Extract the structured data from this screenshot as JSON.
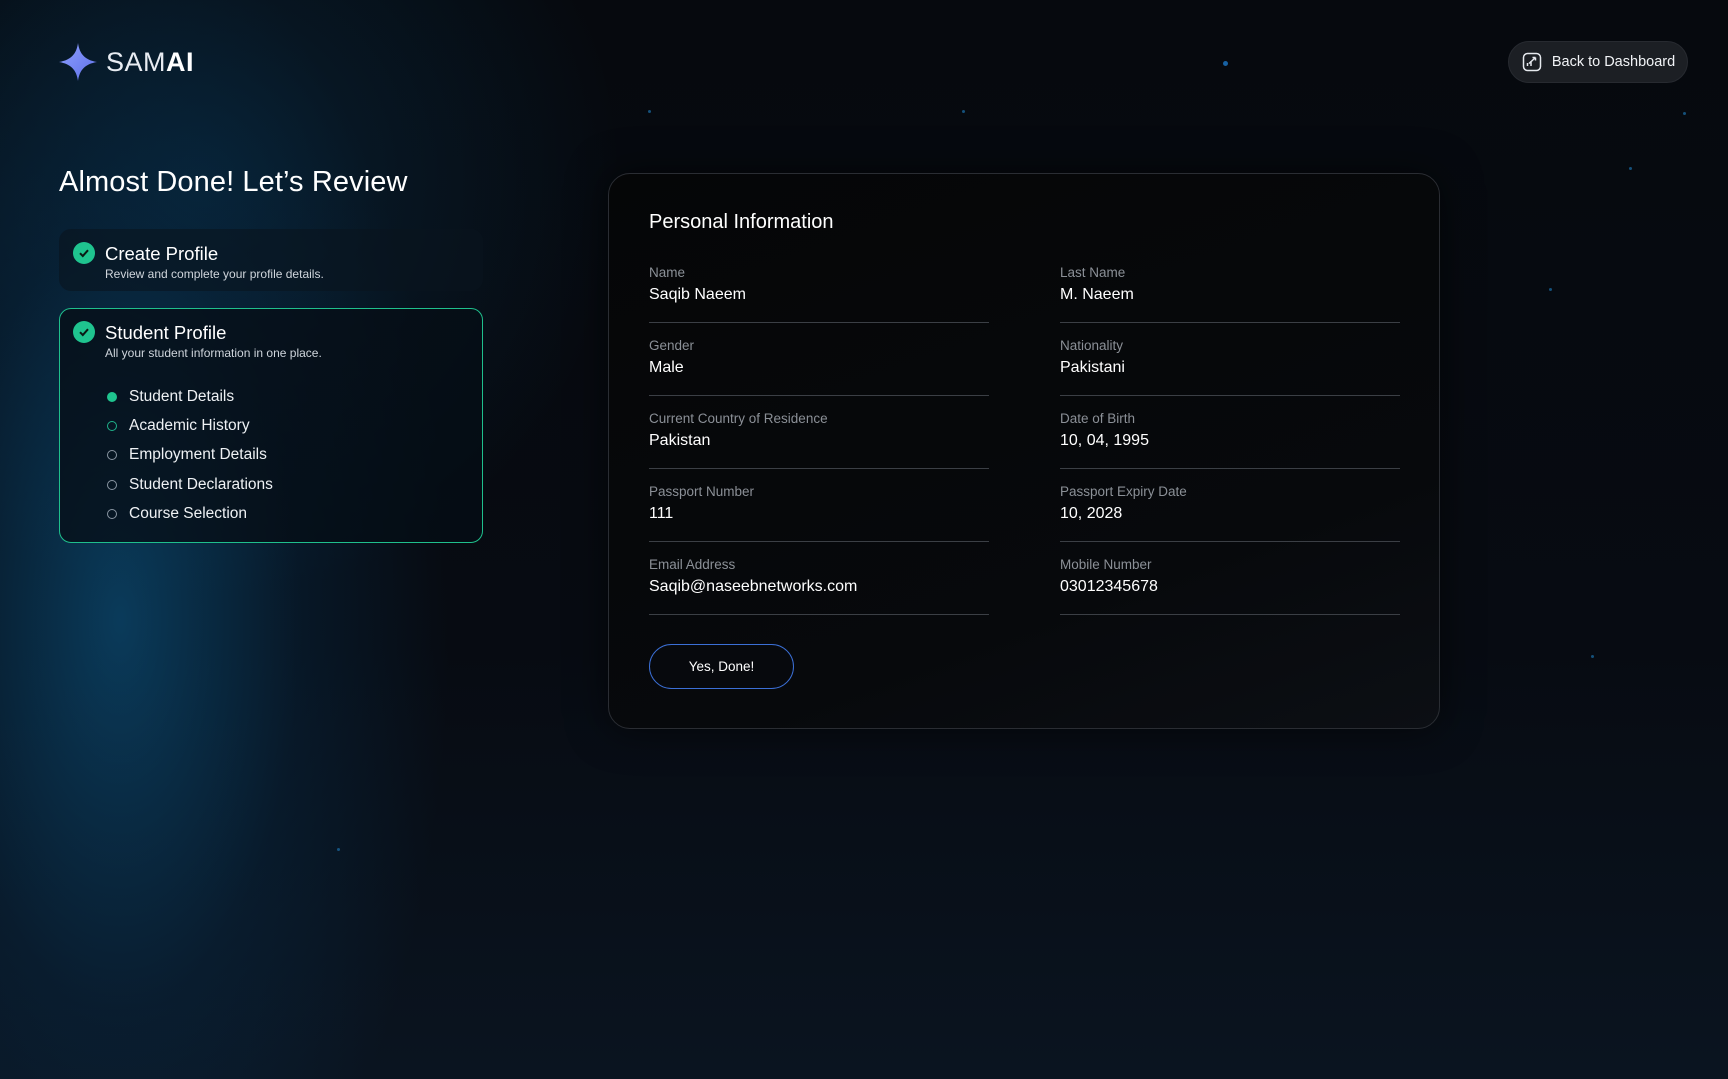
{
  "brand": {
    "logo_light": "SAM",
    "logo_bold": "AI",
    "accent": "#7b8cff"
  },
  "header": {
    "back_label": "Back to Dashboard",
    "back_icon": "chart-box-icon"
  },
  "review": {
    "title": "Almost Done! Let’s Review",
    "steps": [
      {
        "title": "Create Profile",
        "subtitle": "Review and complete your profile details.",
        "status": "complete"
      },
      {
        "title": "Student Profile",
        "subtitle": "All your student information in one place.",
        "status": "complete",
        "items": [
          {
            "label": "Student Details",
            "state": "active"
          },
          {
            "label": "Academic History",
            "state": "pending"
          },
          {
            "label": "Employment Details",
            "state": "pending"
          },
          {
            "label": "Student Declarations",
            "state": "pending"
          },
          {
            "label": "Course Selection",
            "state": "pending"
          }
        ]
      }
    ]
  },
  "personal": {
    "title": "Personal Information",
    "fields": [
      {
        "label": "Name",
        "value": "Saqib Naeem"
      },
      {
        "label": "Last Name",
        "value": "M. Naeem"
      },
      {
        "label": "Gender",
        "value": "Male"
      },
      {
        "label": "Nationality",
        "value": "Pakistani"
      },
      {
        "label": "Current Country of Residence",
        "value": "Pakistan"
      },
      {
        "label": "Date of Birth",
        "value": "10, 04, 1995"
      },
      {
        "label": "Passport Number",
        "value": "111"
      },
      {
        "label": "Passport Expiry Date",
        "value": "10, 2028"
      },
      {
        "label": "Email Address",
        "value": "Saqib@naseebnetworks.com"
      },
      {
        "label": "Mobile Number",
        "value": "03012345678"
      }
    ],
    "confirm_label": "Yes, Done!"
  },
  "colors": {
    "success": "#1fc48f",
    "button_border": "#3b6fd6"
  }
}
